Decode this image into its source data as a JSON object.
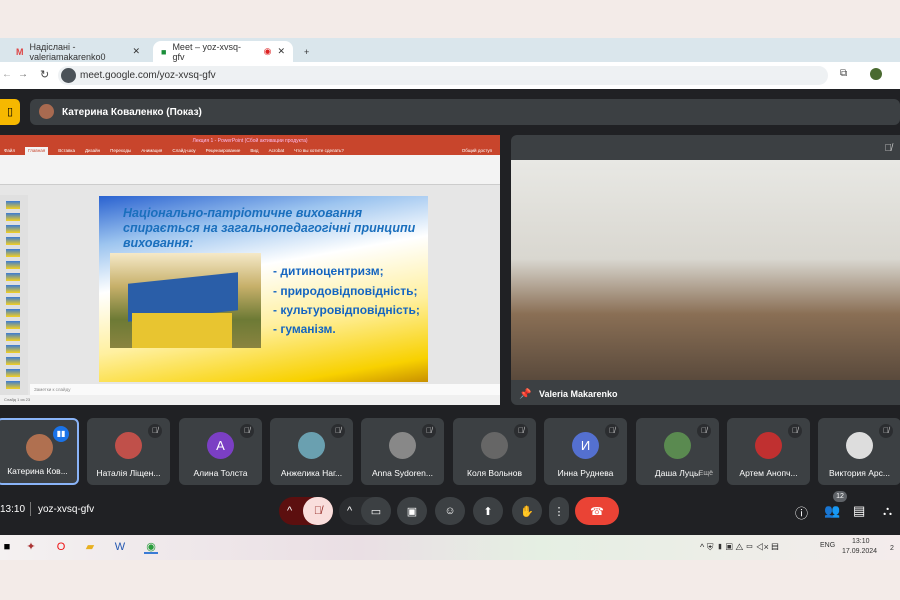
{
  "browser": {
    "tabs": [
      {
        "label": "Надіслані - valeriamakarenko0",
        "icon": "gmail-icon"
      },
      {
        "label": "Meet – yoz-xvsq-gfv",
        "icon": "meet-icon"
      }
    ],
    "url": "meet.google.com/yoz-xvsq-gfv"
  },
  "meet": {
    "presenter_label": "Катерина Коваленко (Показ)",
    "camera_name": "Valeria Makarenko",
    "time": "13:10",
    "meeting_code": "yoz-xvsq-gfv",
    "participants_count": "12",
    "more_label": "Ещё"
  },
  "ppt": {
    "window_title": "Лекция 1 - PowerPoint (Сбой активации продукта)",
    "menu": [
      "Файл",
      "Главная",
      "Вставка",
      "Дизайн",
      "Переходы",
      "Анимация",
      "Слайд-шоу",
      "Рецензирование",
      "Вид",
      "Acrobat",
      "Что вы хотите сделать?"
    ],
    "share": "Общий доступ",
    "notes": "Заметки к слайду",
    "status": "Слайд 1 из 23"
  },
  "slide": {
    "title": "Національно-патріотичне виховання спирається на загальнопедагогічні принципи виховання:",
    "bullets": [
      "- дитиноцентризм;",
      "- природовідповідність;",
      "- культуровідповідність;",
      "- гуманізм."
    ]
  },
  "participants": [
    {
      "name": "Катерина Ков...",
      "initial": "",
      "color": "#b07050",
      "speaking": true
    },
    {
      "name": "Наталія Ліщен...",
      "initial": "",
      "color": "#c0504a"
    },
    {
      "name": "Алина Толста",
      "initial": "A",
      "color": "#7b3fc4"
    },
    {
      "name": "Анжелика Наг...",
      "initial": "",
      "color": "#6aa0b0"
    },
    {
      "name": "Anna Sydoren...",
      "initial": "",
      "color": "#888"
    },
    {
      "name": "Коля Вольнов",
      "initial": "",
      "color": "#666"
    },
    {
      "name": "Инна Руднева",
      "initial": "И",
      "color": "#5470d0"
    },
    {
      "name": "Даша Луцы",
      "initial": "",
      "color": "#5a8a50"
    },
    {
      "name": "Артем Анопч...",
      "initial": "",
      "color": "#c03030"
    },
    {
      "name": "Виктория Арс...",
      "initial": "",
      "color": "#ddd"
    }
  ],
  "taskbar": {
    "lang": "ENG",
    "time": "13:10",
    "date": "17.09.2024",
    "notif": "2"
  },
  "colors": {
    "end_call": "#ea4335",
    "mic_off": "#f9dedc",
    "accent": "#8ab4f8"
  }
}
